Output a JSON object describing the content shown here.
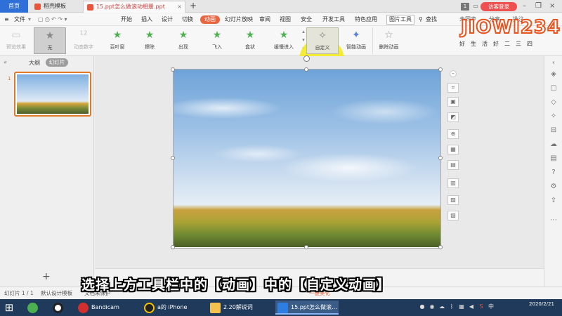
{
  "title_tabs": {
    "home": "首页",
    "tab1": "稻壳模板",
    "tab2": "15.ppt怎么做滚动相册.ppt",
    "new_tab": "+"
  },
  "title_right": {
    "count": "1",
    "login": "访客登录"
  },
  "menu": {
    "file": "文件",
    "items": [
      "开始",
      "插入",
      "设计",
      "切换",
      "动画",
      "幻灯片放映",
      "审阅",
      "视图",
      "安全",
      "开发工具",
      "特色应用",
      "图片工具"
    ],
    "active": "动画",
    "search": "查找",
    "right": [
      "未同步",
      "分享",
      "批注"
    ]
  },
  "ribbon": {
    "buttons": [
      "预览效果",
      "无",
      "动态数字",
      "百叶窗",
      "擦除",
      "出现",
      "飞入",
      "盒状",
      "缓慢进入",
      "自定义",
      "智能动画",
      "删除动画"
    ]
  },
  "logo": {
    "text": "JIOWI234",
    "sub": "好生活好二三四"
  },
  "left_panel": {
    "outline": "大纲",
    "slides": "幻灯片",
    "slide_number": "1",
    "toggle": "«"
  },
  "status": {
    "slide_info": "幻灯片 1 / 1",
    "template": "默认设计模板",
    "protect": "文档未保护",
    "beautify": "一键美化"
  },
  "subtitle": "选择上方工具栏中的【动画】中的【自定义动画】",
  "taskbar": {
    "apps": [
      "Bandicam",
      "a的 iPhone",
      "2.20解说词",
      "15.ppt怎么做滚..."
    ],
    "date": "2020/2/21"
  }
}
